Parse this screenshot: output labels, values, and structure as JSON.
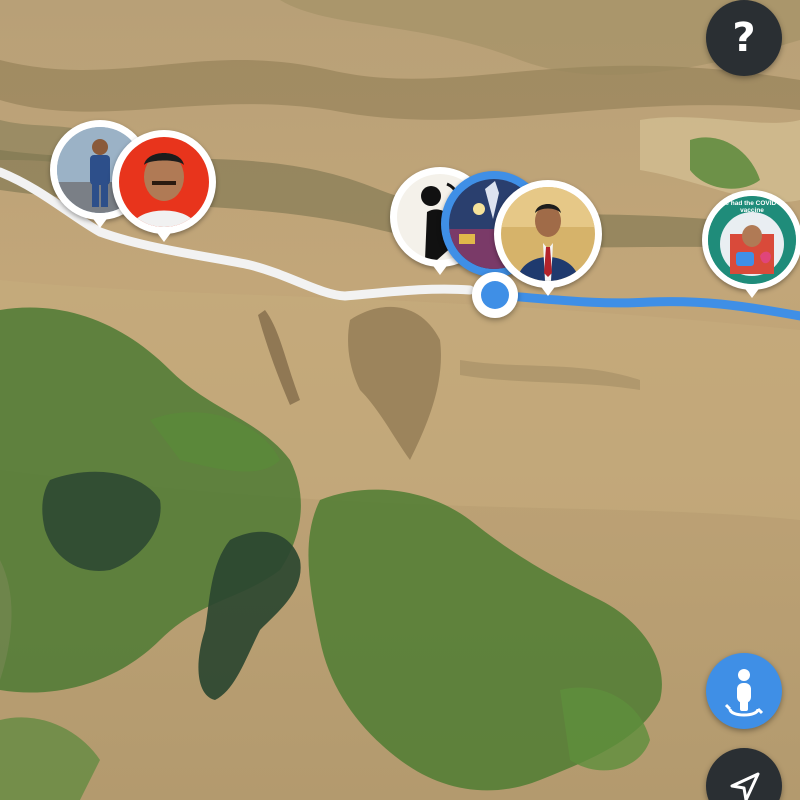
{
  "map": {
    "view": "satellite",
    "route_colors": {
      "traveled": "#f2f2f2",
      "upcoming": "#3f8fe6"
    }
  },
  "controls": {
    "help": {
      "label": "?",
      "icon": "question-mark-icon"
    },
    "street_view": {
      "icon": "pegman-icon",
      "color": "#3f8fe6"
    },
    "my_location": {
      "icon": "navigation-arrow-icon"
    }
  },
  "pins": [
    {
      "id": "user-a",
      "kind": "photo"
    },
    {
      "id": "user-b",
      "kind": "photo"
    },
    {
      "id": "user-c",
      "kind": "photo"
    },
    {
      "id": "user-d",
      "kind": "photo",
      "active": true
    },
    {
      "id": "user-e",
      "kind": "photo"
    },
    {
      "id": "user-f",
      "kind": "badge",
      "badge_text": "I've had the COVID-19 vaccine",
      "accent": "#1f8c7a"
    }
  ],
  "current_position": {
    "icon": "current-location-dot",
    "color": "#3f8fe6"
  }
}
